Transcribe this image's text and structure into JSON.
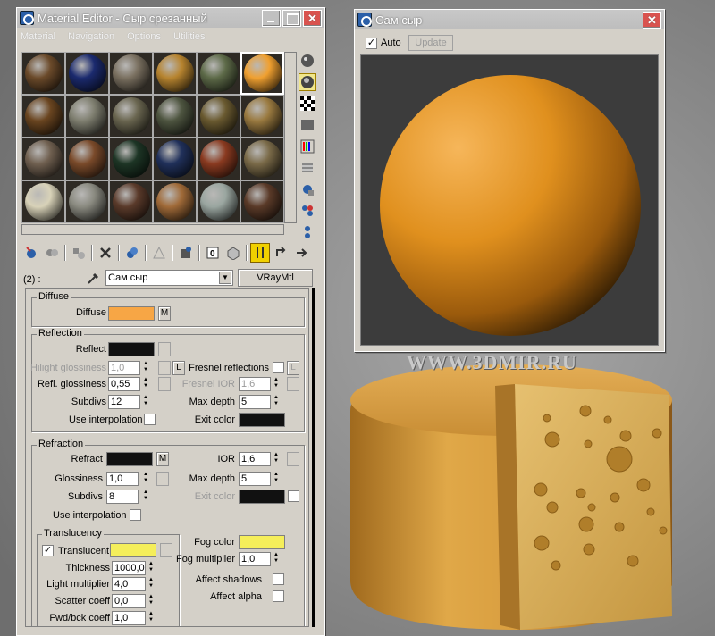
{
  "colors": {
    "orange": "#f7a645",
    "yellow": "#f5ee5a",
    "black": "#111111"
  },
  "material_editor": {
    "title": "Material Editor - Сыр срезанный",
    "menu": [
      "Material",
      "Navigation",
      "Options",
      "Utilities"
    ],
    "sample_slots": [
      {
        "color": "#6b4a2a"
      },
      {
        "color": "#1b2a6e"
      },
      {
        "color": "#7a7060"
      },
      {
        "color": "#b7842f"
      },
      {
        "color": "#5d6a48"
      },
      {
        "color": "#f0a030"
      },
      {
        "color": "#6a4520"
      },
      {
        "color": "#7f7f70"
      },
      {
        "color": "#6a6650"
      },
      {
        "color": "#4e5540"
      },
      {
        "color": "#6a5a30"
      },
      {
        "color": "#9a7a40"
      },
      {
        "color": "#706050"
      },
      {
        "color": "#7a4a2a"
      },
      {
        "color": "#1d3525"
      },
      {
        "color": "#20305a"
      },
      {
        "color": "#8a3a20"
      },
      {
        "color": "#7a6a48"
      },
      {
        "color": "#d8d2b8"
      },
      {
        "color": "#8a8a80"
      },
      {
        "color": "#5a3a2a"
      },
      {
        "color": "#a06a38"
      },
      {
        "color": "#9aa6a0"
      },
      {
        "color": "#5a3a28"
      }
    ],
    "slot_label": "(2) :",
    "material_name": "Сам сыр",
    "material_type": "VRayMtl",
    "diffuse": {
      "section": "Diffuse",
      "label": "Diffuse",
      "m": "M"
    },
    "reflection": {
      "section": "Reflection",
      "reflect": "Reflect",
      "hilight_gloss_label": "Hilight glossiness",
      "hilight_gloss": "1,0",
      "l": "L",
      "refl_gloss_label": "Refl. glossiness",
      "refl_gloss": "0,55",
      "subdivs_label": "Subdivs",
      "subdivs": "12",
      "use_interp": "Use interpolation",
      "fresnel_label": "Fresnel reflections",
      "fresnel_ior_label": "Fresnel IOR",
      "fresnel_ior": "1,6",
      "max_depth_label": "Max depth",
      "max_depth": "5",
      "exit_color": "Exit color"
    },
    "refraction": {
      "section": "Refraction",
      "refract": "Refract",
      "m": "M",
      "gloss_label": "Glossiness",
      "gloss": "1,0",
      "subdivs_label": "Subdivs",
      "subdivs": "8",
      "use_interp": "Use interpolation",
      "ior_label": "IOR",
      "ior": "1,6",
      "max_depth_label": "Max depth",
      "max_depth": "5",
      "exit_color": "Exit color"
    },
    "translucency": {
      "section": "Translucency",
      "translucent": "Translucent",
      "thickness_label": "Thickness",
      "thickness": "1000,0",
      "light_mult_label": "Light multiplier",
      "light_mult": "4,0",
      "scatter_label": "Scatter coeff",
      "scatter": "0,0",
      "fwd_label": "Fwd/bck coeff",
      "fwd": "1,0",
      "fog_color": "Fog color",
      "fog_mult_label": "Fog multiplier",
      "fog_mult": "1,0",
      "affect_shadows": "Affect shadows",
      "affect_alpha": "Affect alpha"
    }
  },
  "preview": {
    "title": "Сам сыр",
    "auto": "Auto",
    "update": "Update"
  },
  "watermark": "WWW.3DMIR.RU"
}
